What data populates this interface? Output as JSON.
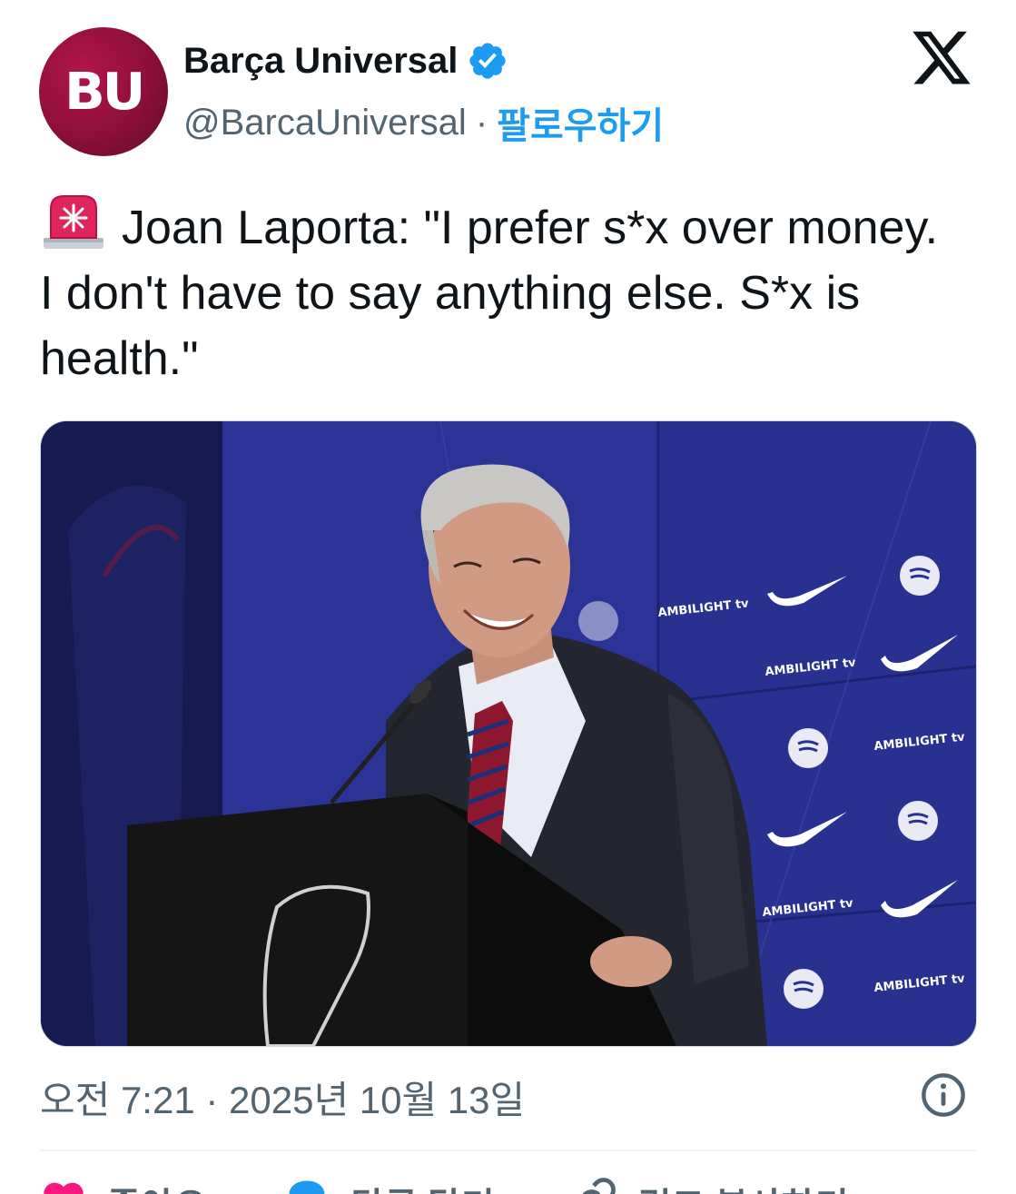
{
  "author": {
    "avatar_text": "BU",
    "name": "Barça Universal",
    "handle": "@BarcaUniversal",
    "separator": "·",
    "follow_label": "팔로우하기"
  },
  "tweet": {
    "emoji_icon": "police-siren-icon",
    "text": "Joan Laporta: \"I prefer s*x over money. I don't have to say anything else. S*x is health.\""
  },
  "media": {
    "backdrop_texts": [
      "AMBILIGHT tv",
      "AMBILIGHT tv",
      "AMBILIGHT tv",
      "AMBILIGHT tv",
      "AMBILIGHT tv"
    ]
  },
  "footer": {
    "timestamp": "오전 7:21 · 2025년 10월 13일"
  },
  "actions": {
    "like_label": "좋아요",
    "reply_label": "답글 달기",
    "copy_link_label": "링크 복사하기"
  },
  "colors": {
    "accent": "#1d9bf0",
    "text": "#0f1419",
    "muted": "#536471",
    "like": "#f91880",
    "avatar": "#8c0f3a"
  }
}
